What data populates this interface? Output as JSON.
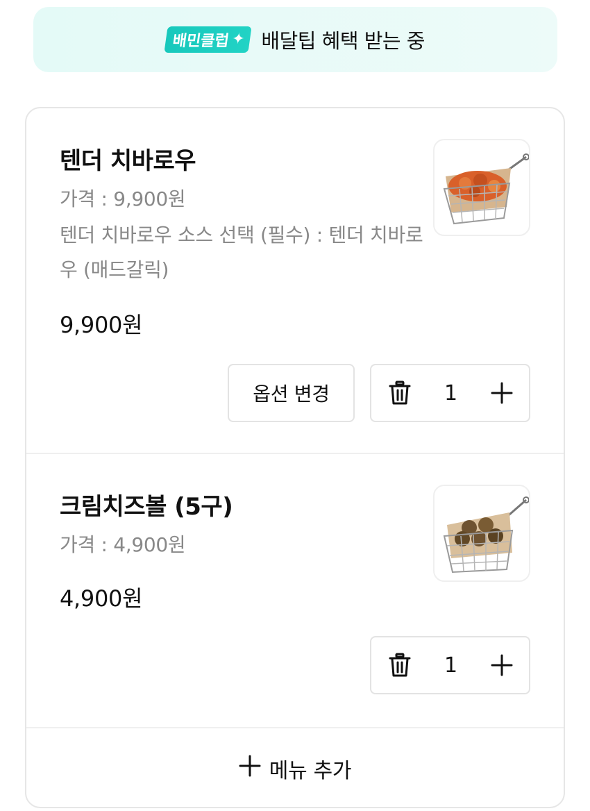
{
  "banner": {
    "badge_label": "배민클럽",
    "text": "배달팁 혜택 받는 중",
    "accent_color": "#1cccbf"
  },
  "cart": {
    "items": [
      {
        "name": "텐더 치바로우",
        "price_line": "가격 : 9,900원",
        "option_line": "텐더 치바로우 소스 선택 (필수) : 텐더 치바로우 (매드갈릭)",
        "total": "9,900원",
        "image_icon": "fried-chicken-basket-image",
        "option_button_label": "옵션 변경",
        "quantity": "1"
      },
      {
        "name": "크림치즈볼 (5구)",
        "price_line": "가격 : 4,900원",
        "total": "4,900원",
        "image_icon": "cheese-ball-basket-image",
        "quantity": "1"
      }
    ],
    "add_menu_label": "메뉴 추가"
  }
}
